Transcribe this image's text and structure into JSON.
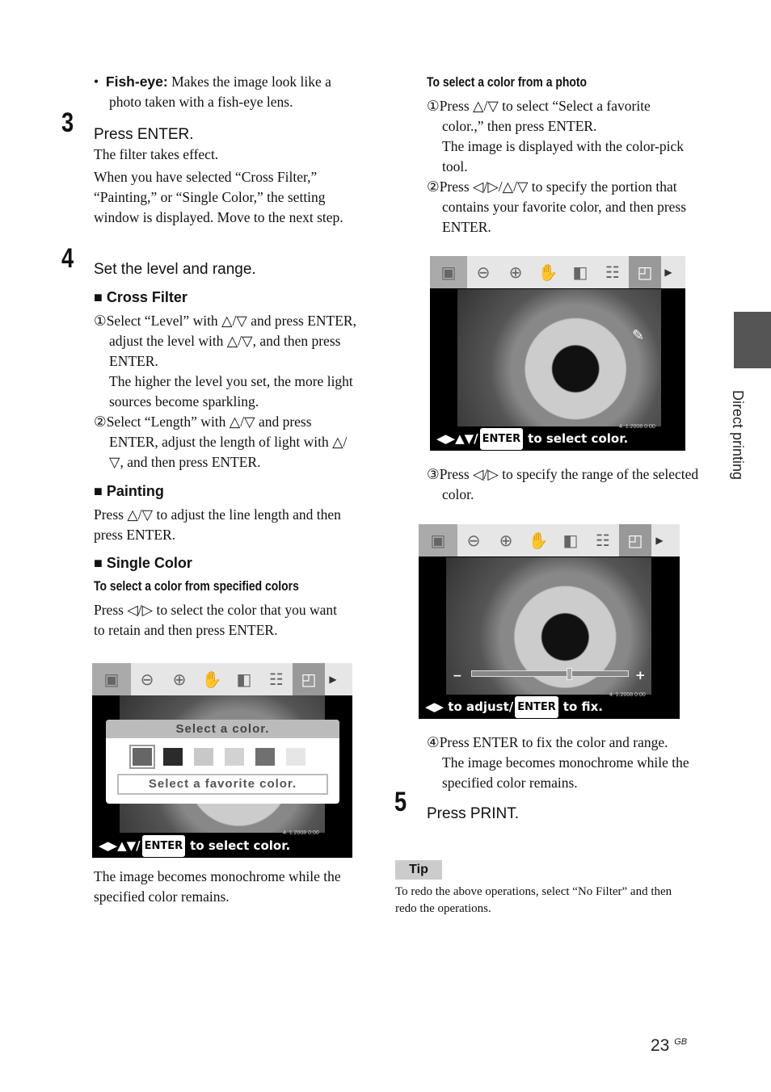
{
  "left": {
    "fisheye_bullet": "•",
    "fisheye_term": "Fish-eye:",
    "fisheye_text": "Makes the image look like a photo taken with a fish-eye lens.",
    "step3_num": "3",
    "step3_head": "Press ENTER.",
    "step3_p1": "The filter takes effect.",
    "step3_p2": "When you have selected “Cross Filter,” “Painting,” or “Single Color,” the setting window is displayed. Move to the next step.",
    "step4_num": "4",
    "step4_head": "Set the level and range.",
    "cross_head": "■ Cross Filter",
    "cross_1": "①Select “Level” with △/▽ and press ENTER, adjust the level with △/▽, and then press ENTER.",
    "cross_1b": "The higher the level you set, the more light sources become sparkling.",
    "cross_2": "②Select “Length” with △/▽ and press ENTER, adjust the length of light with △/▽, and then press ENTER.",
    "paint_head": "■ Painting",
    "paint_text": "Press △/▽ to adjust the line length and then press ENTER.",
    "single_head": "■ Single Color",
    "single_sub": "To select a color from specified colors",
    "single_text": "Press ◁/▷ to select the color that you want to retain and then press ENTER.",
    "after": "The image becomes monochrome while the specified color remains."
  },
  "right": {
    "photo_sub": "To select a color from a photo",
    "p1": "①Press △/▽ to select “Select a favorite color.,” then press ENTER.",
    "p1b": "The image is displayed with the color-pick tool.",
    "p2": "②Press ◁/▷/△/▽ to specify the portion that contains your favorite color, and then press ENTER.",
    "p3": "③Press ◁/▷ to specify the range of the selected color.",
    "p4": "④Press ENTER to fix the color and range.",
    "p4b": "The image becomes monochrome while the specified color remains.",
    "step5_num": "5",
    "step5_head": "Press PRINT.",
    "tip_label": "Tip",
    "tip_text": "To redo the above operations, select “No Filter” and then redo the operations."
  },
  "screens": {
    "toolbar_icons": [
      "edit-photo",
      "zoom-out",
      "zoom-in",
      "hand",
      "rotate",
      "adjust",
      "filter",
      "more"
    ],
    "date": "4. 1.2008  0:00",
    "s1": {
      "dialog_title": "Select a color.",
      "swatches": [
        "#666666",
        "#2b2b2b",
        "#c8c8c8",
        "#d2d2d2",
        "#707070",
        "#e6e6e6"
      ],
      "favorite_button": "Select a favorite color.",
      "arrows": "◀▶▲▼/",
      "enter": "ENTER",
      "hint": "to select color."
    },
    "s2": {
      "arrows": "◀▶▲▼/",
      "enter": "ENTER",
      "hint": "to select color."
    },
    "s3": {
      "minus": "−",
      "plus": "+",
      "arrows": "◀▶ to adjust/",
      "enter": "ENTER",
      "hint": "to fix.",
      "slider_value": 0.62
    }
  },
  "side_tab": "Direct printing",
  "footer": {
    "page": "23",
    "suffix": "GB"
  }
}
